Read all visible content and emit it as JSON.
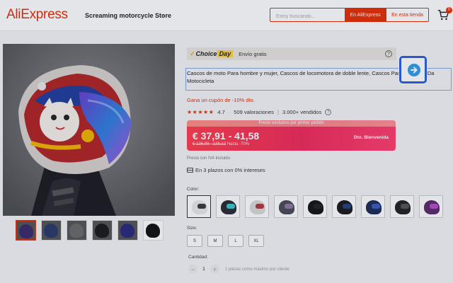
{
  "header": {
    "logo": "AliExpress",
    "store_name": "Screaming motorcycle Store",
    "search_placeholder": "Estoy buscando...",
    "search_aliexpress": "En AliExpress",
    "search_store": "En esta tienda",
    "cart_count": "0"
  },
  "choice": {
    "label": "Choice",
    "label2": "Day",
    "envio": "Envío gratis"
  },
  "product": {
    "title": "Cascos de moto Para hombre y mujer, Cascos de locomotora de doble lente, Cascos Para capacete Da Motocicleta",
    "coupon": "Gana un cupón de -10% dto.",
    "rating": "4.7",
    "reviews": "509 valoraciones",
    "sold": "3.000+ vendidos",
    "price_banner": "Precio exclusivo por primer pedido",
    "price": "€ 37,91 - 41,58",
    "price_old": "€ 126,99 - 138,12",
    "price_hasta": "Hasta -70%",
    "discount_tag": "Dto. Bienvenida",
    "iva": "Precio con IVA incluido",
    "plazos": "En 3 plazos con 0% intereses"
  },
  "color": {
    "label": "Color:",
    "swatches": [
      {
        "helmet": "#e9e9e9",
        "visor": "#3a3a3a"
      },
      {
        "helmet": "#2b2b33",
        "visor": "#3fc4c8"
      },
      {
        "helmet": "#d9d9d9",
        "visor": "#b03a3a"
      },
      {
        "helmet": "#4a4a55",
        "visor": "#8a7a9a"
      },
      {
        "helmet": "#141414",
        "visor": "#222"
      },
      {
        "helmet": "#1a1a1a",
        "visor": "#2a3f7a"
      },
      {
        "helmet": "#1c2c55",
        "visor": "#3b5bbf"
      },
      {
        "helmet": "#222",
        "visor": "#555"
      },
      {
        "helmet": "#5a2a6a",
        "visor": "#b34fc7"
      }
    ]
  },
  "size": {
    "label": "Size:",
    "options": [
      "S",
      "M",
      "L",
      "XL"
    ]
  },
  "quantity": {
    "label": "Cantidad:",
    "value": "1",
    "note": "1 piezas como máximo por cliente"
  },
  "thumbs": [
    {
      "color": "#3b2a6a"
    },
    {
      "color": "#2a3b6a"
    },
    {
      "color": "#6a6a6a"
    },
    {
      "color": "#1a1a1a"
    },
    {
      "color": "#2a2a7a"
    },
    {
      "color": "#111111"
    }
  ]
}
